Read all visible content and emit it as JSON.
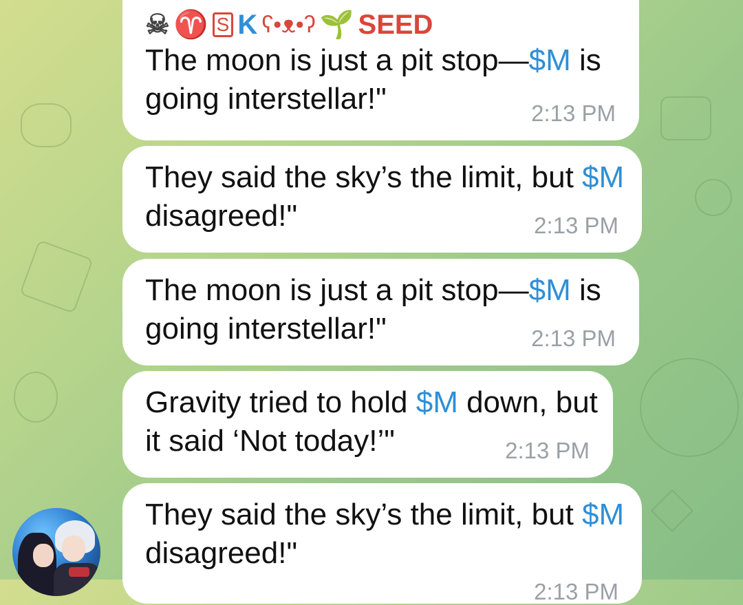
{
  "sender": {
    "prefix_icons": [
      "skull-and-crossbones-icon",
      "aries-icon",
      "s-square-icon"
    ],
    "skull_glyph": "☠",
    "aries_glyph": "♈",
    "s_letter": "S",
    "k_letter": "K",
    "face_glyph": "ʕ•ᴥ•ʔ",
    "sprout_glyph": "🌱",
    "name": "SEED"
  },
  "messages": [
    {
      "parts": [
        "The moon is just a pit stop—",
        "$M",
        " is going interstellar!\""
      ],
      "time": "2:13 PM"
    },
    {
      "parts": [
        "They said the sky’s the limit, but ",
        "$M",
        " disagreed!\""
      ],
      "time": "2:13 PM"
    },
    {
      "parts": [
        "The moon is just a pit stop—",
        "$M",
        " is going interstellar!\""
      ],
      "time": "2:13 PM"
    },
    {
      "parts": [
        "Gravity tried to hold ",
        "$M",
        " down, but it said ‘Not today!’\""
      ],
      "time": "2:13 PM"
    },
    {
      "parts": [
        "They said the sky’s the limit, but ",
        "$M",
        " disagreed!\""
      ],
      "time": "2:13 PM"
    }
  ],
  "colors": {
    "ticker": "#2f8fd6",
    "sender_name": "#d9463b",
    "sender_k": "#2f8fd6",
    "time": "#9aa0a6",
    "bubble": "#ffffff"
  }
}
